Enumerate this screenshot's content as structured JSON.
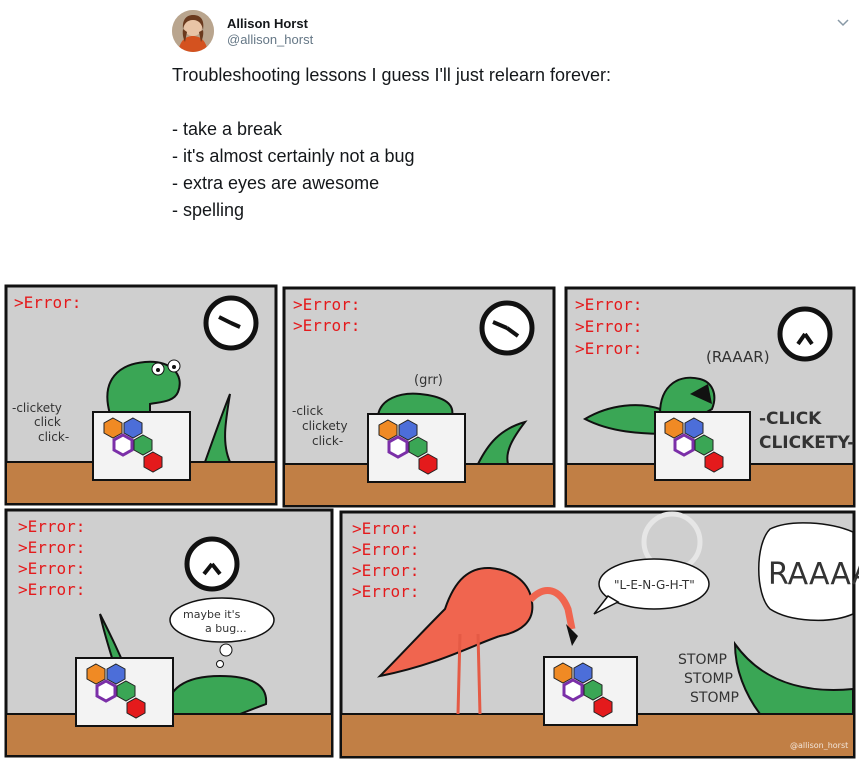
{
  "tweet": {
    "author_name": "Allison Horst",
    "author_handle": "@allison_horst",
    "lines": [
      "Troubleshooting lessons I guess I'll just relearn forever:",
      "- take a break",
      "- it's almost certainly not a bug",
      "- extra eyes are awesome",
      "- spelling"
    ]
  },
  "icons": {
    "menu": "chevron-down-icon",
    "avatar": "avatar"
  },
  "comic": {
    "error_text": ">Error:",
    "panel1_sound": [
      "-clickety",
      "click",
      "click-"
    ],
    "panel2_sound": [
      "-click",
      "clickety",
      "click-"
    ],
    "panel2_growl": "(grr)",
    "panel3_roar": "(RAAAR)",
    "panel3_sound": [
      "-CLICK",
      "CLICKETY-"
    ],
    "panel4_thought": [
      "maybe it's",
      "a bug..."
    ],
    "panel5_speech": "\"L-E-N-G-H-T\"",
    "panel5_roar": "RAAAA",
    "panel5_stomp": [
      "STOMP",
      "STOMP",
      "STOMP"
    ],
    "credit": "@allison_horst"
  },
  "colors": {
    "error_red": "#e41a1c",
    "panel_bg": "#cfcfcf",
    "desk": "#c17f45",
    "alligator": "#3aa655",
    "flamingo": "#f0654f"
  }
}
